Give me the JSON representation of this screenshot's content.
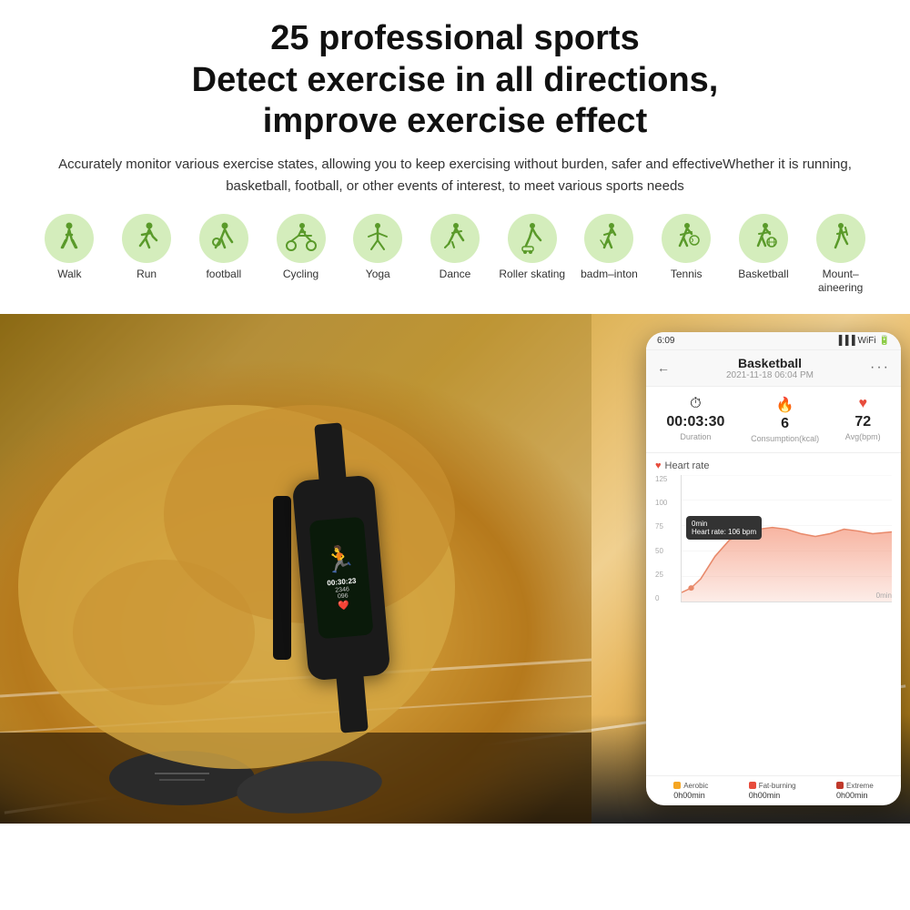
{
  "header": {
    "main_title": "25 professional sports",
    "sub_title1": "Detect exercise in all directions,",
    "sub_title2": "improve exercise effect",
    "description": "Accurately monitor various exercise states, allowing you to keep exercising without burden, safer and effectiveWhether it is running, basketball, football, or other events of interest, to meet various sports needs"
  },
  "sports": [
    {
      "id": "walk",
      "label": "Walk",
      "icon": "🚶"
    },
    {
      "id": "run",
      "label": "Run",
      "icon": "🏃"
    },
    {
      "id": "football",
      "label": "football",
      "icon": "⚽"
    },
    {
      "id": "cycling",
      "label": "Cycling",
      "icon": "🚴"
    },
    {
      "id": "yoga",
      "label": "Yoga",
      "icon": "🧘"
    },
    {
      "id": "dance",
      "label": "Dance",
      "icon": "💃"
    },
    {
      "id": "roller-skating",
      "label": "Roller skating",
      "icon": "⛸"
    },
    {
      "id": "badminton",
      "label": "badm–inton",
      "icon": "🏸"
    },
    {
      "id": "tennis",
      "label": "Tennis",
      "icon": "🎾"
    },
    {
      "id": "basketball",
      "label": "Basketball",
      "icon": "🏀"
    },
    {
      "id": "mountaineering",
      "label": "Mount–aineering",
      "icon": "🧗"
    }
  ],
  "band": {
    "time": "00:30:23",
    "steps": "2346",
    "heart_rate": "096",
    "heart_icon": "❤"
  },
  "phone": {
    "status_bar": {
      "time": "6:09",
      "signal": "▐▐▐",
      "wifi": "WiFi",
      "battery": "🔋"
    },
    "activity": {
      "title": "Basketball",
      "date": "2021-11-18 06:04 PM"
    },
    "stats": {
      "duration": {
        "value": "00:03:30",
        "label": "Duration",
        "icon": "⏱"
      },
      "calories": {
        "value": "6",
        "label": "Consumption(kcal)",
        "icon": "🔥"
      },
      "heart_rate": {
        "value": "72",
        "label": "Avg(bpm)",
        "icon": "❤"
      }
    },
    "chart": {
      "title": "Heart rate",
      "y_labels": [
        "125",
        "100",
        "75",
        "50",
        "25",
        "0"
      ],
      "x_label": "0min",
      "tooltip": {
        "line1": "0min",
        "line2": "Heart rate: 106 bpm"
      }
    },
    "zones": [
      {
        "label": "Aerobic",
        "time": "0h00min",
        "color": "#f5a623"
      },
      {
        "label": "Fat-burning",
        "time": "0h00min",
        "color": "#e74c3c"
      },
      {
        "label": "Extreme",
        "time": "0h00min",
        "color": "#c0392b"
      }
    ]
  }
}
